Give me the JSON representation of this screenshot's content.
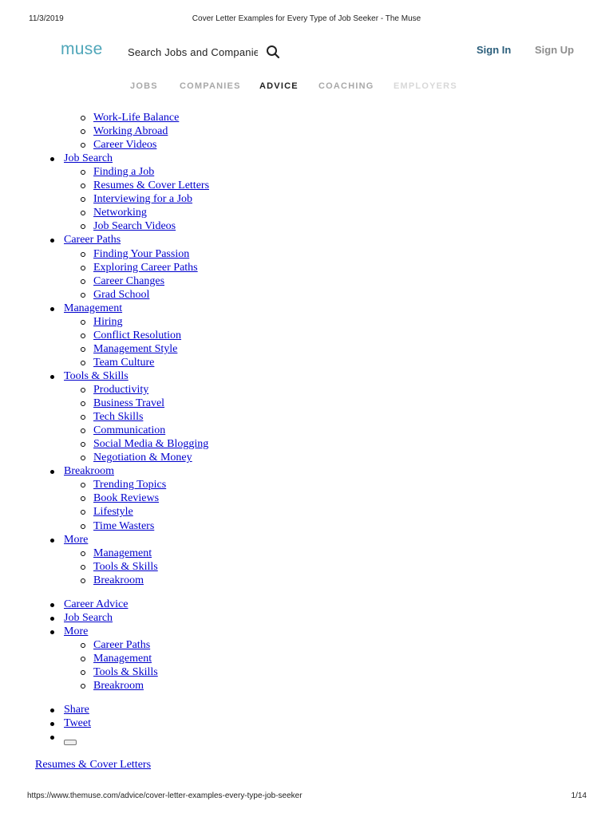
{
  "print_header": {
    "date": "11/3/2019",
    "title": "Cover Letter Examples for Every Type of Job Seeker - The Muse"
  },
  "print_footer": {
    "url": "https://www.themuse.com/advice/cover-letter-examples-every-type-job-seeker",
    "page": "1/14"
  },
  "header": {
    "logo": "muse",
    "search_placeholder": "Search Jobs and Companies",
    "sign_in": "Sign In",
    "sign_up": "Sign Up"
  },
  "nav": {
    "items": [
      {
        "label": "JOBS",
        "color": "#a8a8a8"
      },
      {
        "label": "COMPANIES",
        "color": "#a8a8a8"
      },
      {
        "label": "ADVICE",
        "color": "#222222"
      },
      {
        "label": "COACHING",
        "color": "#a8a8a8"
      },
      {
        "label": "EMPLOYERS",
        "color": "#d8d8d8"
      }
    ]
  },
  "menu": {
    "career_advice_subs": [
      "Work-Life Balance",
      "Working Abroad",
      "Career Videos"
    ],
    "sections": [
      {
        "label": "Job Search",
        "items": [
          "Finding a Job",
          "Resumes & Cover Letters",
          "Interviewing for a Job",
          "Networking",
          "Job Search Videos"
        ]
      },
      {
        "label": "Career Paths",
        "items": [
          "Finding Your Passion",
          "Exploring Career Paths",
          "Career Changes",
          "Grad School"
        ]
      },
      {
        "label": "Management",
        "items": [
          "Hiring",
          "Conflict Resolution",
          "Management Style",
          "Team Culture"
        ]
      },
      {
        "label": "Tools & Skills",
        "items": [
          "Productivity",
          "Business Travel",
          "Tech Skills",
          "Communication",
          "Social Media & Blogging",
          "Negotiation & Money"
        ]
      },
      {
        "label": "Breakroom",
        "items": [
          "Trending Topics",
          "Book Reviews",
          "Lifestyle",
          "Time Wasters"
        ]
      },
      {
        "label": "More",
        "items": [
          "Management",
          "Tools & Skills",
          "Breakroom"
        ]
      }
    ]
  },
  "secondary_menu": {
    "career_advice": "Career Advice",
    "job_search": "Job Search",
    "more": "More",
    "more_items": [
      "Career Paths",
      "Management",
      "Tools & Skills",
      "Breakroom"
    ]
  },
  "share": {
    "share": "Share",
    "tweet": "Tweet"
  },
  "breadcrumb": "Resumes & Cover Letters"
}
